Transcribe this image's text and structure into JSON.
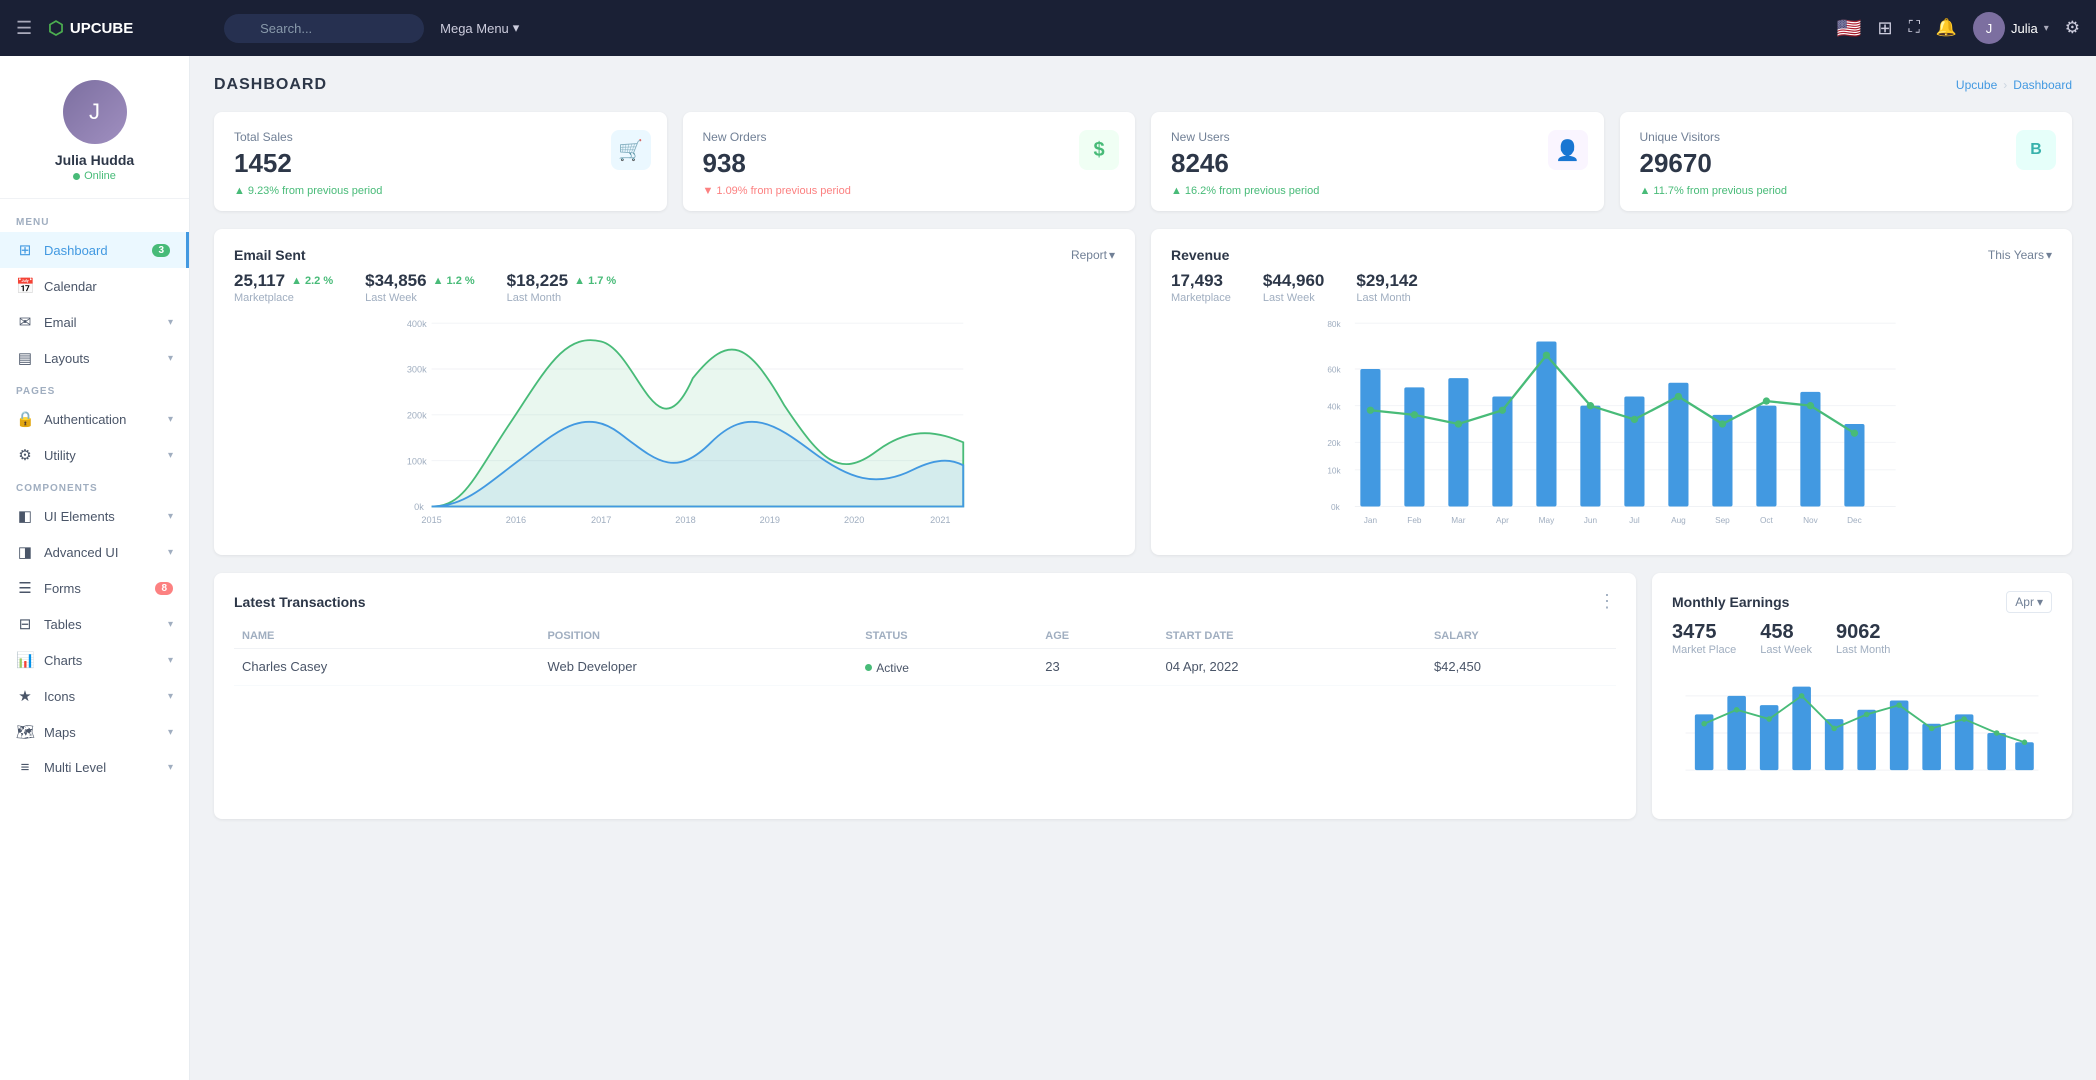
{
  "topnav": {
    "brand": "UPCUBE",
    "search_placeholder": "Search...",
    "megamenu_label": "Mega Menu",
    "user_name": "Julia",
    "flag_emoji": "🇺🇸"
  },
  "sidebar": {
    "user": {
      "name": "Julia Hudda",
      "status": "Online"
    },
    "sections": [
      {
        "label": "MENU",
        "items": [
          {
            "id": "dashboard",
            "label": "Dashboard",
            "icon": "⊞",
            "badge": "3",
            "badge_type": "green",
            "active": true
          },
          {
            "id": "calendar",
            "label": "Calendar",
            "icon": "📅",
            "arrow": true
          },
          {
            "id": "email",
            "label": "Email",
            "icon": "✉",
            "arrow": true
          },
          {
            "id": "layouts",
            "label": "Layouts",
            "icon": "⊟",
            "arrow": true
          }
        ]
      },
      {
        "label": "PAGES",
        "items": [
          {
            "id": "authentication",
            "label": "Authentication",
            "icon": "🔒",
            "arrow": true
          },
          {
            "id": "utility",
            "label": "Utility",
            "icon": "⚙",
            "arrow": true
          }
        ]
      },
      {
        "label": "COMPONENTS",
        "items": [
          {
            "id": "ui-elements",
            "label": "UI Elements",
            "icon": "◧",
            "arrow": true
          },
          {
            "id": "advanced-ui",
            "label": "Advanced UI",
            "icon": "◨",
            "arrow": true
          },
          {
            "id": "forms",
            "label": "Forms",
            "icon": "☰",
            "badge": "8",
            "badge_type": "red"
          },
          {
            "id": "tables",
            "label": "Tables",
            "icon": "⊞",
            "arrow": true
          },
          {
            "id": "charts",
            "label": "Charts",
            "icon": "📊",
            "arrow": true
          },
          {
            "id": "icons",
            "label": "Icons",
            "icon": "★",
            "arrow": true
          },
          {
            "id": "maps",
            "label": "Maps",
            "icon": "🗺",
            "arrow": true
          },
          {
            "id": "multi-level",
            "label": "Multi Level",
            "icon": "≡",
            "arrow": true
          }
        ]
      }
    ]
  },
  "page": {
    "title": "DASHBOARD",
    "breadcrumb": [
      "Upcube",
      "Dashboard"
    ]
  },
  "stat_cards": [
    {
      "label": "Total Sales",
      "value": "1452",
      "change": "9.23%",
      "direction": "up",
      "suffix": "from previous period",
      "icon": "🛒",
      "icon_style": "blue"
    },
    {
      "label": "New Orders",
      "value": "938",
      "change": "1.09%",
      "direction": "down",
      "suffix": "from previous period",
      "icon": "$",
      "icon_style": "green"
    },
    {
      "label": "New Users",
      "value": "8246",
      "change": "16.2%",
      "direction": "up",
      "suffix": "from previous period",
      "icon": "👤",
      "icon_style": "purple"
    },
    {
      "label": "Unique Visitors",
      "value": "29670",
      "change": "11.7%",
      "direction": "up",
      "suffix": "from previous period",
      "icon": "B",
      "icon_style": "teal"
    }
  ],
  "email_chart": {
    "title": "Email Sent",
    "action": "Report",
    "stats": [
      {
        "value": "25,117",
        "pct": "2.2 %",
        "pct_dir": "up",
        "label": "Marketplace"
      },
      {
        "value": "$34,856",
        "pct": "1.2 %",
        "pct_dir": "up",
        "label": "Last Week"
      },
      {
        "value": "$18,225",
        "pct": "1.7 %",
        "pct_dir": "up",
        "label": "Last Month"
      }
    ],
    "years": [
      "2015",
      "2016",
      "2017",
      "2018",
      "2019",
      "2020",
      "2021"
    ],
    "y_labels": [
      "400k",
      "300k",
      "200k",
      "100k",
      "0k"
    ]
  },
  "revenue_chart": {
    "title": "Revenue",
    "action": "This Years",
    "stats": [
      {
        "value": "17,493",
        "label": "Marketplace"
      },
      {
        "value": "$44,960",
        "label": "Last Week"
      },
      {
        "value": "$29,142",
        "label": "Last Month"
      }
    ],
    "months": [
      "Jan",
      "Feb",
      "Mar",
      "Apr",
      "May",
      "Jun",
      "Jul",
      "Aug",
      "Sep",
      "Oct",
      "Nov",
      "Dec"
    ],
    "y_labels": [
      "80k",
      "60k",
      "40k",
      "20k",
      "10k",
      "0k"
    ]
  },
  "transactions": {
    "title": "Latest Transactions",
    "columns": [
      "Name",
      "Position",
      "Status",
      "Age",
      "Start date",
      "Salary"
    ],
    "rows": [
      {
        "name": "Charles Casey",
        "position": "Web Developer",
        "status": "Active",
        "age": "23",
        "start_date": "04 Apr, 2022",
        "salary": "$42,450"
      }
    ]
  },
  "monthly_earnings": {
    "title": "Monthly Earnings",
    "filter": "Apr",
    "stats": [
      {
        "value": "3475",
        "label": "Market Place"
      },
      {
        "value": "458",
        "label": "Last Week"
      },
      {
        "value": "9062",
        "label": "Last Month"
      }
    ]
  }
}
